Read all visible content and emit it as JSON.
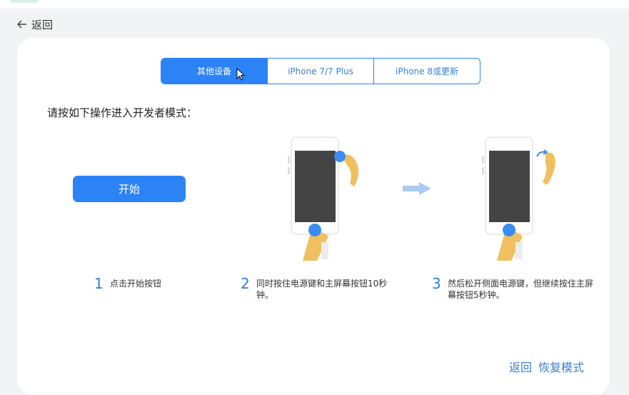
{
  "header": {
    "back_label": "返回"
  },
  "tabs": [
    {
      "label": "其他设备",
      "active": true
    },
    {
      "label": "iPhone 7/7 Plus",
      "active": false
    },
    {
      "label": "iPhone 8或更新",
      "active": false
    }
  ],
  "instruction": "请按如下操作进入开发者模式：",
  "start_button": "开始",
  "steps": [
    {
      "number": "1",
      "text": "点击开始按钮"
    },
    {
      "number": "2",
      "text": "同时按住电源键和主屏幕按钮10秒钟。"
    },
    {
      "number": "3",
      "text": "然后松开侧面电源键，但继续按住主屏幕按钮5秒钟。"
    }
  ],
  "footer": {
    "back_label": "返回",
    "recovery_label": "恢复模式"
  },
  "colors": {
    "accent": "#2b83f6",
    "link": "#3a7fd0",
    "card": "#ffffff",
    "background": "#f2f3f5"
  },
  "icons": [
    "back-arrow-icon",
    "mouse-cursor-icon",
    "right-arrow-icon",
    "phone-illustration",
    "release-arrow-icon"
  ]
}
